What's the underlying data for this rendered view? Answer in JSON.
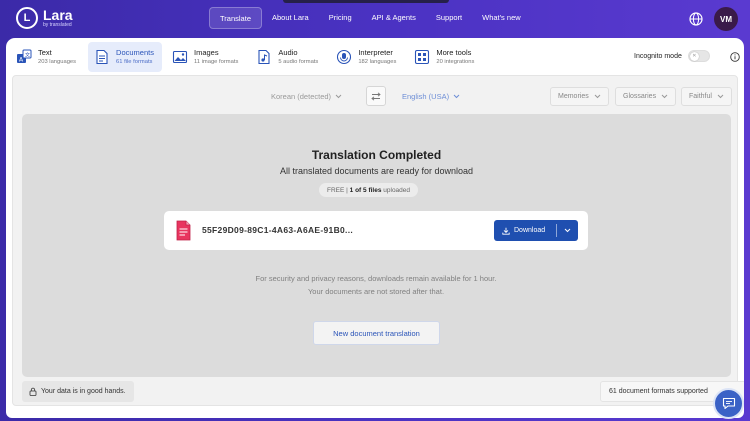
{
  "logo": {
    "mark": "L",
    "name": "Lara",
    "sub": "by translated"
  },
  "nav": {
    "items": [
      {
        "label": "Translate",
        "active": true
      },
      {
        "label": "About Lara"
      },
      {
        "label": "Pricing"
      },
      {
        "label": "API & Agents"
      },
      {
        "label": "Support"
      },
      {
        "label": "What's new"
      }
    ]
  },
  "user": {
    "initials": "VM"
  },
  "tools": [
    {
      "title": "Text",
      "sub": "203 languages",
      "icon": "text-translate-icon"
    },
    {
      "title": "Documents",
      "sub": "61 file formats",
      "icon": "document-icon",
      "active": true
    },
    {
      "title": "Images",
      "sub": "11 image formats",
      "icon": "image-icon"
    },
    {
      "title": "Audio",
      "sub": "5 audio formats",
      "icon": "audio-file-icon"
    },
    {
      "title": "Interpreter",
      "sub": "182 languages",
      "icon": "interpreter-icon"
    },
    {
      "title": "More tools",
      "sub": "20 integrations",
      "icon": "grid-icon"
    }
  ],
  "incognito": {
    "label": "Incognito mode",
    "on": false
  },
  "languages": {
    "source": "Korean (detected)",
    "target": "English (USA)"
  },
  "options": {
    "memories": "Memories",
    "glossaries": "Glossaries",
    "style": "Faithful"
  },
  "result": {
    "title": "Translation Completed",
    "subtitle": "All translated documents are ready for download",
    "plan_prefix": "FREE |",
    "plan_count": "1 of 5 files",
    "plan_suffix": "uploaded",
    "file_name": "55F29D09-89C1-4A63-A6AE-91B0...",
    "download_label": "Download",
    "notice": "For security and privacy reasons, downloads remain available for 1 hour. Your documents are not stored after that.",
    "new_label": "New document translation"
  },
  "footer": {
    "safe": "Your data is in good hands.",
    "formats": "61 document formats supported"
  },
  "colors": {
    "brand": "#4a32c2",
    "accent": "#1f4fb0",
    "link": "#2a54b8"
  }
}
